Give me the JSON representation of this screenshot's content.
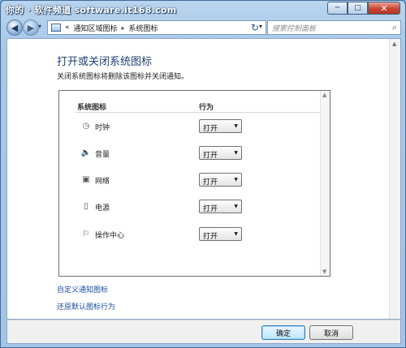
{
  "watermark": "你的 · 软件频道 software.it168.com",
  "window_controls": {
    "minimize": "─",
    "maximize": "□",
    "close": "✕"
  },
  "address_bar": {
    "prefix": "«",
    "crumbs": [
      "通知区域图标",
      "系统图标"
    ],
    "separator": "▸",
    "dropdown": "▾"
  },
  "search": {
    "placeholder": "搜索控制面板",
    "icon": "search-icon"
  },
  "page": {
    "title": "打开或关闭系统图标",
    "description": "关闭系统图标将删除该图标并关闭通知。"
  },
  "table": {
    "headers": {
      "icons": "系统图标",
      "behavior": "行为"
    },
    "rows": [
      {
        "icon": "clock-icon",
        "glyph": "◷",
        "label": "时钟",
        "value": "打开"
      },
      {
        "icon": "volume-icon",
        "glyph": "🔈",
        "label": "音量",
        "value": "打开"
      },
      {
        "icon": "network-icon",
        "glyph": "▣",
        "label": "网络",
        "value": "打开"
      },
      {
        "icon": "power-icon",
        "glyph": "▯",
        "label": "电源",
        "value": "打开"
      },
      {
        "icon": "action-center-flag-icon",
        "glyph": "⚐",
        "label": "操作中心",
        "value": "打开"
      }
    ]
  },
  "links": {
    "customize": "自定义通知图标",
    "restore": "还原默认图标行为"
  },
  "buttons": {
    "ok": "确定",
    "cancel": "取消"
  },
  "colors": {
    "title": "#1e3e73",
    "link": "#1a4ea6",
    "frame": "#a3c4e6"
  }
}
